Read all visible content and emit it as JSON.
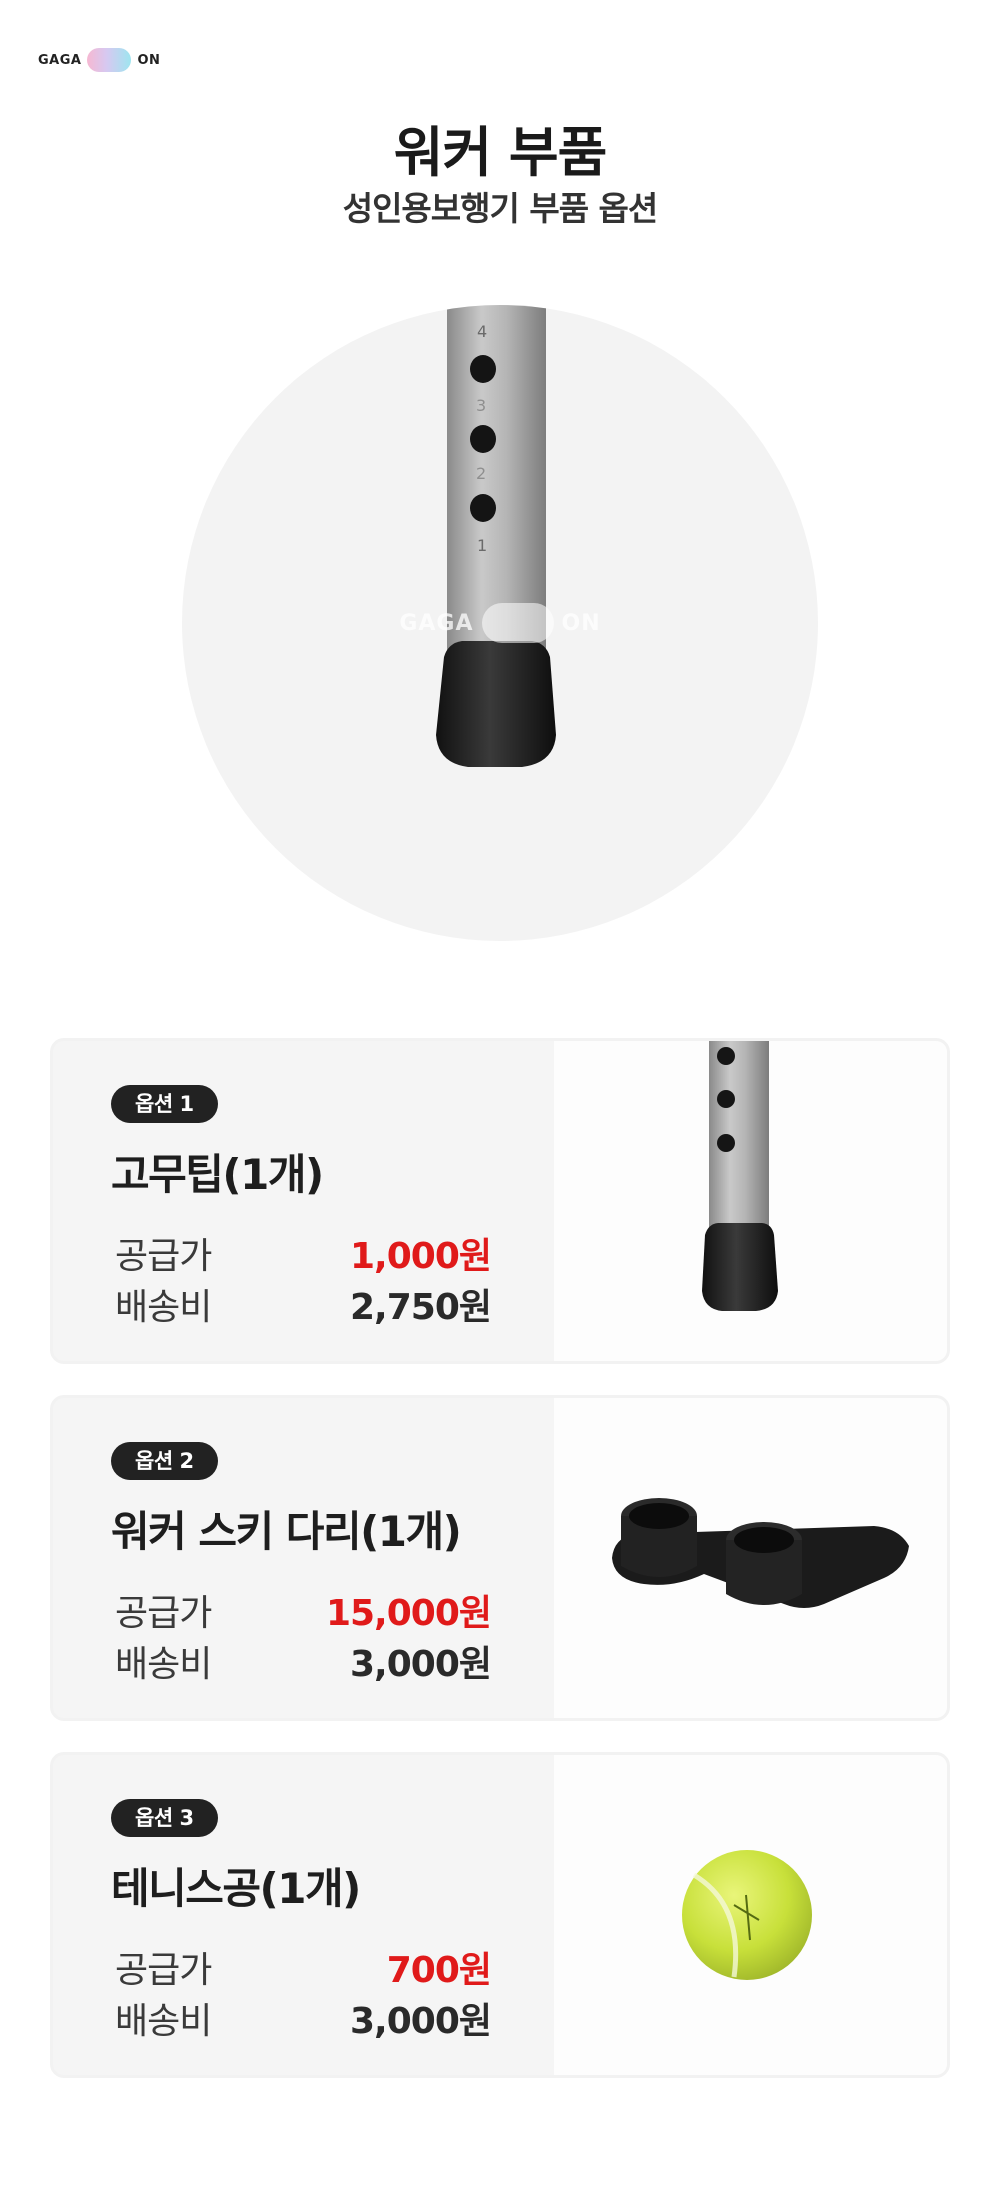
{
  "logo": {
    "left": "GAGA",
    "right": "ON"
  },
  "header": {
    "title": "워커 부품",
    "subtitle": "성인용보행기 부품 옵션"
  },
  "hero": {
    "watermark_left": "GAGA",
    "watermark_right": "ON",
    "tube_numbers": [
      "4",
      "3",
      "2",
      "1"
    ]
  },
  "options": [
    {
      "badge": "옵션 1",
      "name": "고무팁(1개)",
      "supply_label": "공급가",
      "supply_value": "1,000원",
      "shipping_label": "배송비",
      "shipping_value": "2,750원",
      "image": "rubber-tip-photo"
    },
    {
      "badge": "옵션 2",
      "name": "워커 스키 다리(1개)",
      "supply_label": "공급가",
      "supply_value": "15,000원",
      "shipping_label": "배송비",
      "shipping_value": "3,000원",
      "image": "walker-ski-glide-photo"
    },
    {
      "badge": "옵션 3",
      "name": "테니스공(1개)",
      "supply_label": "공급가",
      "supply_value": "700원",
      "shipping_label": "배송비",
      "shipping_value": "3,000원",
      "image": "tennis-ball-photo"
    }
  ],
  "colors": {
    "price": "#e01a1a",
    "badge_bg": "#222222",
    "card_bg": "#f5f5f5"
  }
}
